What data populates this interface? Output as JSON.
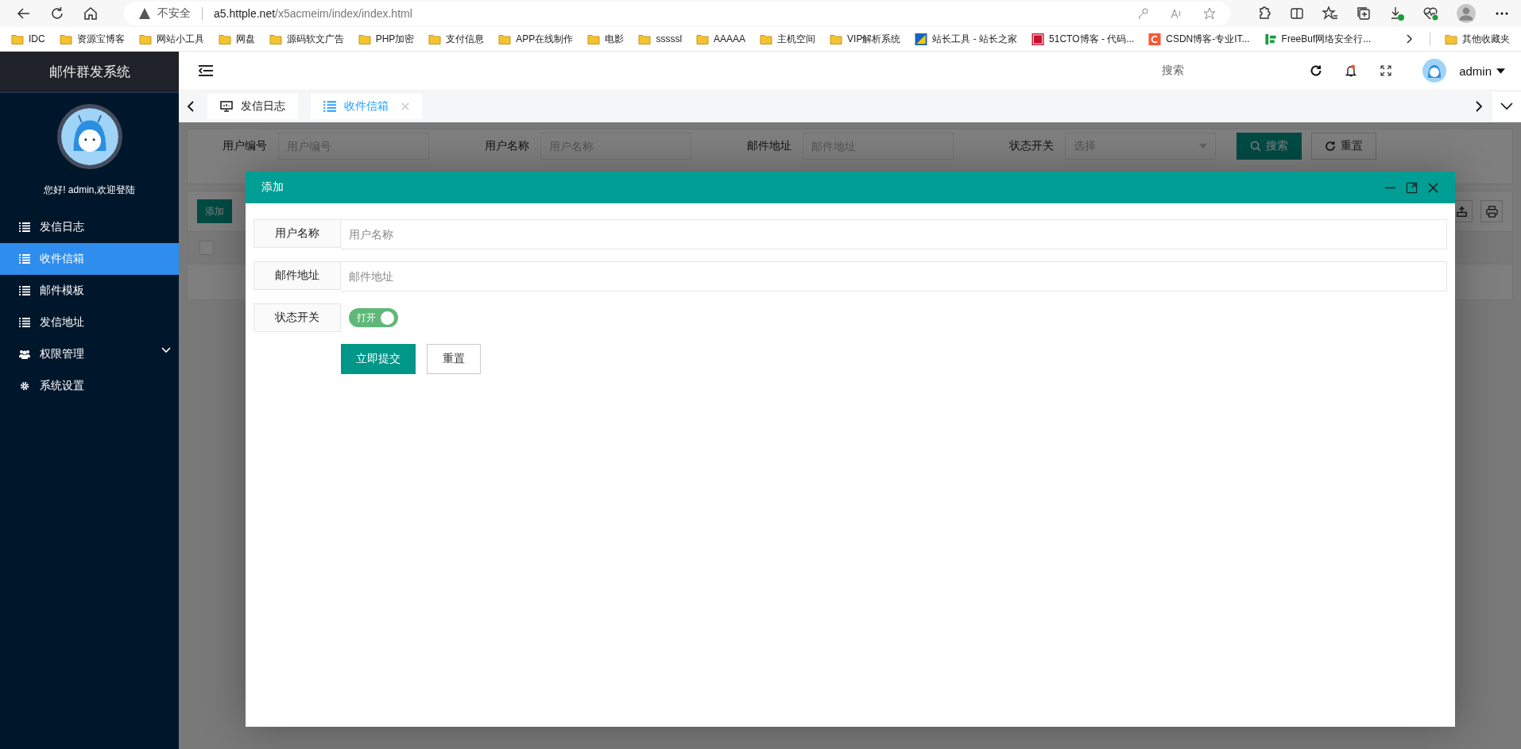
{
  "browser": {
    "security": "不安全",
    "url_host": "a5.httple.net",
    "url_path": "/x5acmeim/index/index.html",
    "bookmarks": [
      {
        "label": "IDC",
        "kind": "folder"
      },
      {
        "label": "资源宝博客",
        "kind": "folder"
      },
      {
        "label": "网站小工具",
        "kind": "folder"
      },
      {
        "label": "网盘",
        "kind": "folder"
      },
      {
        "label": "源码软文广告",
        "kind": "folder"
      },
      {
        "label": "PHP加密",
        "kind": "folder"
      },
      {
        "label": "支付信息",
        "kind": "folder"
      },
      {
        "label": "APP在线制作",
        "kind": "folder"
      },
      {
        "label": "电影",
        "kind": "folder"
      },
      {
        "label": "sssssl",
        "kind": "folder"
      },
      {
        "label": "AAAAA",
        "kind": "folder"
      },
      {
        "label": "主机空间",
        "kind": "folder"
      },
      {
        "label": "VIP解析系统",
        "kind": "folder"
      },
      {
        "label": "站长工具 - 站长之家",
        "kind": "chinaz"
      },
      {
        "label": "51CTO博客 - 代码...",
        "kind": "cto"
      },
      {
        "label": "CSDN博客-专业IT...",
        "kind": "csdn"
      },
      {
        "label": "FreeBuf网络安全行...",
        "kind": "freebuf"
      }
    ],
    "other_bookmarks": "其他收藏夹"
  },
  "sidebar": {
    "title": "邮件群发系统",
    "greeting": "您好! admin,欢迎登陆",
    "items": [
      {
        "label": "发信日志",
        "kind": "list",
        "selected": false,
        "expandable": false
      },
      {
        "label": "收件信箱",
        "kind": "list",
        "selected": true,
        "expandable": false
      },
      {
        "label": "邮件模板",
        "kind": "list",
        "selected": false,
        "expandable": false
      },
      {
        "label": "发信地址",
        "kind": "list",
        "selected": false,
        "expandable": false
      },
      {
        "label": "权限管理",
        "kind": "users",
        "selected": false,
        "expandable": true
      },
      {
        "label": "系统设置",
        "kind": "gear",
        "selected": false,
        "expandable": false
      }
    ]
  },
  "header": {
    "search": "搜索",
    "user": "admin"
  },
  "tabs": [
    {
      "label": "发信日志",
      "kind": "monitor",
      "selected": false,
      "closable": false
    },
    {
      "label": "收件信箱",
      "kind": "list",
      "selected": true,
      "closable": true
    }
  ],
  "filter": {
    "fields": [
      {
        "label": "用户编号",
        "placeholder": "用户编号",
        "kind": "input"
      },
      {
        "label": "用户名称",
        "placeholder": "用户名称",
        "kind": "input"
      },
      {
        "label": "邮件地址",
        "placeholder": "邮件地址",
        "kind": "input"
      },
      {
        "label": "状态开关",
        "placeholder": "选择",
        "kind": "select"
      }
    ],
    "search_button": "搜索",
    "reset_button": "重置"
  },
  "toolbar": {
    "add_button": "添加"
  },
  "table": {
    "header_checked": false
  },
  "dialog": {
    "title": "添加",
    "fields": [
      {
        "label": "用户名称",
        "kind": "text",
        "placeholder": "用户名称"
      },
      {
        "label": "邮件地址",
        "kind": "text",
        "placeholder": "邮件地址"
      },
      {
        "label": "状态开关",
        "kind": "switch",
        "on": true,
        "text": "打开"
      }
    ],
    "submit_button": "立即提交",
    "reset_button": "重置"
  }
}
